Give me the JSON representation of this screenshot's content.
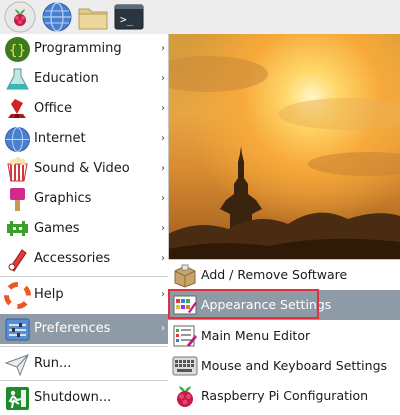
{
  "main_menu": {
    "items": [
      {
        "label": "Programming",
        "icon": "programming-icon",
        "has_submenu": true
      },
      {
        "label": "Education",
        "icon": "education-icon",
        "has_submenu": true
      },
      {
        "label": "Office",
        "icon": "office-icon",
        "has_submenu": true
      },
      {
        "label": "Internet",
        "icon": "internet-icon",
        "has_submenu": true
      },
      {
        "label": "Sound & Video",
        "icon": "sound-video-icon",
        "has_submenu": true
      },
      {
        "label": "Graphics",
        "icon": "graphics-icon",
        "has_submenu": true
      },
      {
        "label": "Games",
        "icon": "games-icon",
        "has_submenu": true
      },
      {
        "label": "Accessories",
        "icon": "accessories-icon",
        "has_submenu": true
      },
      {
        "label": "Help",
        "icon": "help-icon",
        "has_submenu": true
      },
      {
        "label": "Preferences",
        "icon": "preferences-icon",
        "has_submenu": true,
        "active": true
      },
      {
        "label": "Run...",
        "icon": "run-icon",
        "has_submenu": false
      },
      {
        "label": "Shutdown...",
        "icon": "shutdown-icon",
        "has_submenu": false
      }
    ],
    "arrow": "›"
  },
  "preferences_submenu": {
    "items": [
      {
        "label": "Add / Remove Software",
        "icon": "package-icon"
      },
      {
        "label": "Appearance Settings",
        "icon": "appearance-icon",
        "hovered": true
      },
      {
        "label": "Main Menu Editor",
        "icon": "menu-editor-icon"
      },
      {
        "label": "Mouse and Keyboard Settings",
        "icon": "keyboard-icon"
      },
      {
        "label": "Raspberry Pi Configuration",
        "icon": "raspberry-icon"
      }
    ]
  },
  "colors": {
    "active_bg": "#8e9aa6",
    "highlight_border": "#e0303a",
    "taskbar_bg": "#ededed"
  }
}
